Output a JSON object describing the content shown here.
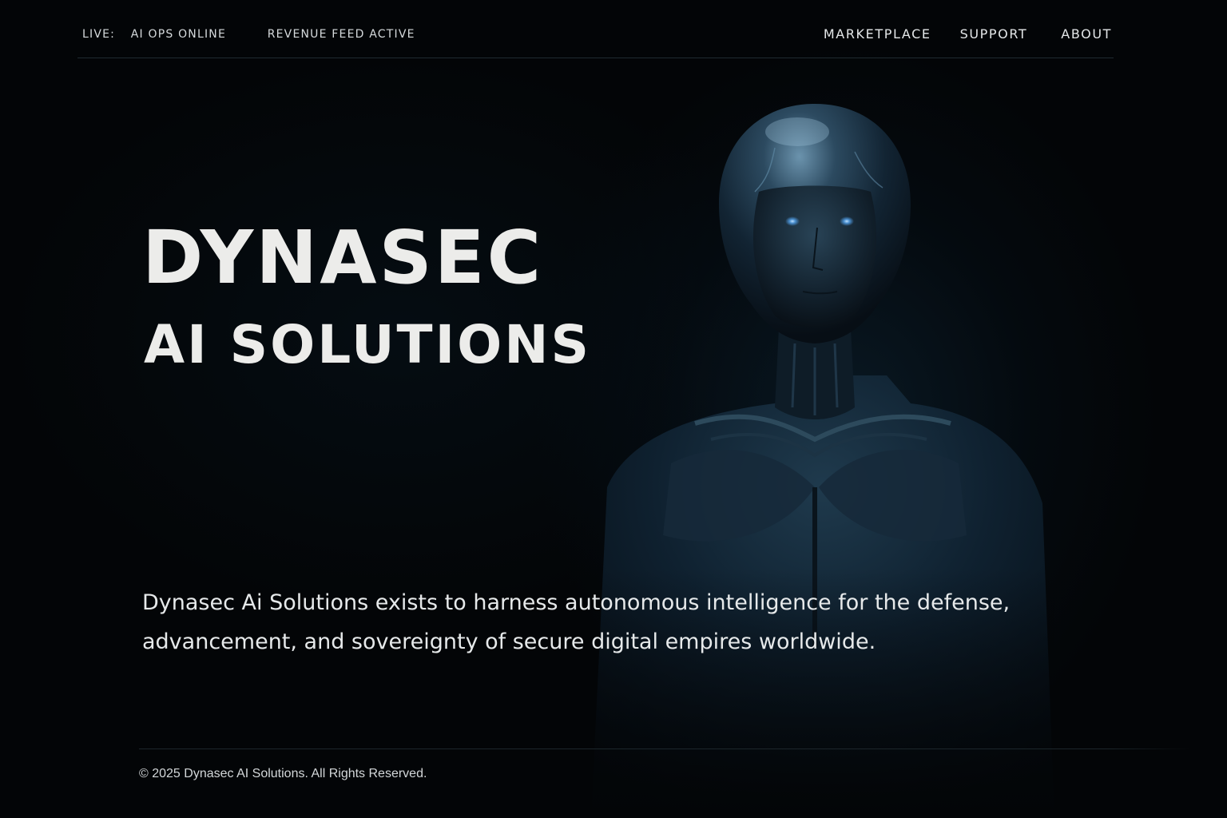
{
  "topbar": {
    "status_label": "LIVE:",
    "status_items": [
      "AI OPS ONLINE",
      "REVENUE FEED ACTIVE"
    ],
    "nav": [
      "MARKETPLACE",
      "SUPPORT",
      "ABOUT"
    ]
  },
  "hero": {
    "title_line1": "DYNASEC",
    "title_line2": "AI SOLUTIONS",
    "mission": "Dynasec Ai Solutions exists to harness autonomous intelligence for the defense, advancement, and sovereignty of secure digital empires worldwide.",
    "image_icon": "android-figure-image"
  },
  "footer": {
    "copyright": "© 2025 Dynasec AI Solutions. All Rights Reserved."
  },
  "colors": {
    "background": "#030507",
    "text": "#ececea",
    "accent_glow": "#4a8fd0"
  }
}
